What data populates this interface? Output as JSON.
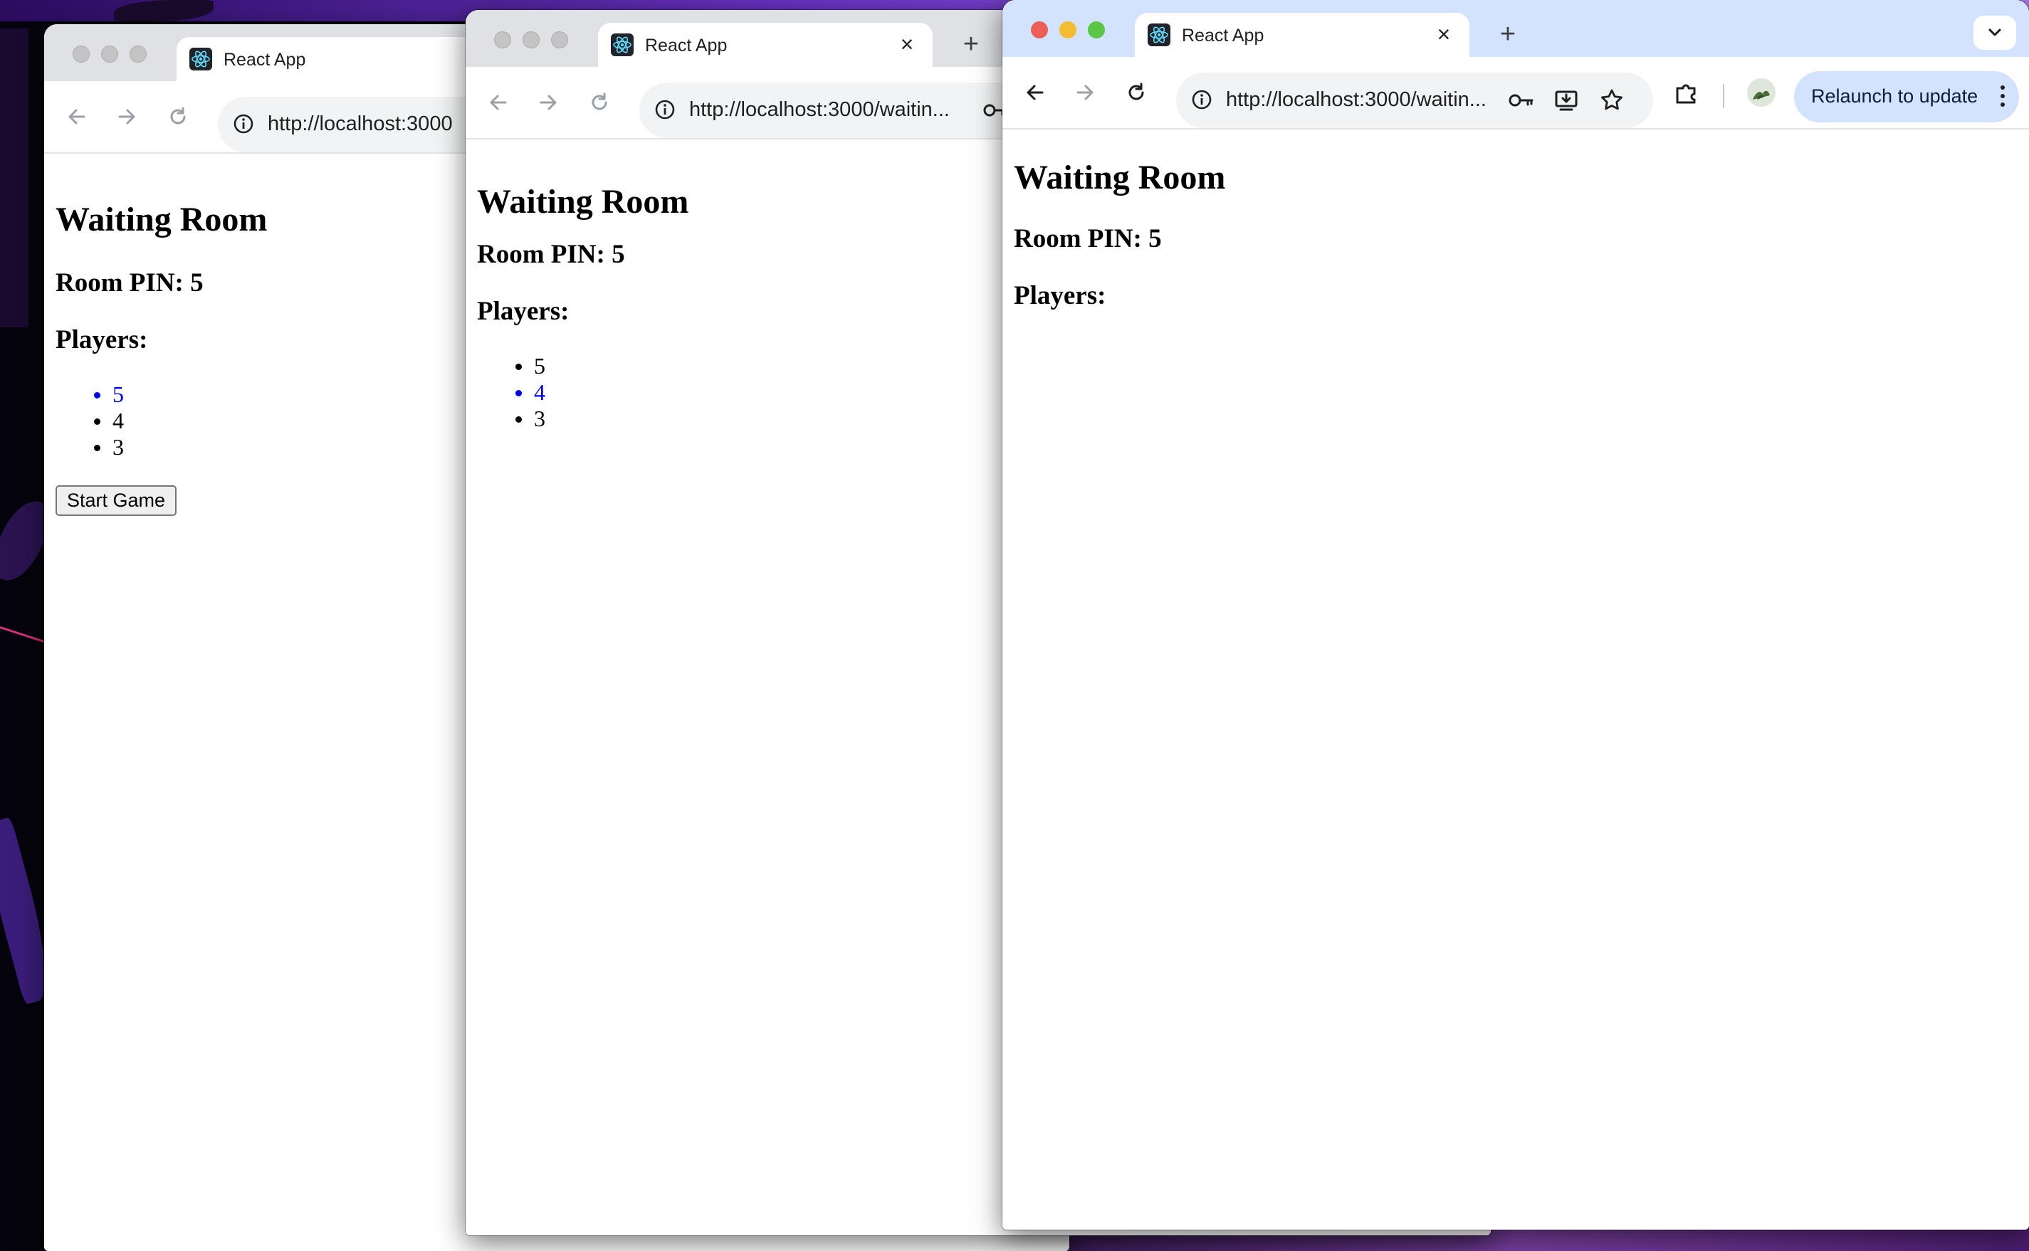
{
  "windows": [
    {
      "tab_title": "React App",
      "url": "http://localhost:3000",
      "heading": "Waiting Room",
      "room_pin": "Room PIN: 5",
      "players_label": "Players:",
      "players": [
        {
          "name": "5",
          "highlighted": true
        },
        {
          "name": "4",
          "highlighted": false
        },
        {
          "name": "3",
          "highlighted": false
        }
      ],
      "start_button": "Start Game"
    },
    {
      "tab_title": "React App",
      "url": "http://localhost:3000/waitin...",
      "heading": "Waiting Room",
      "room_pin": "Room PIN: 5",
      "players_label": "Players:",
      "players": [
        {
          "name": "5",
          "highlighted": false
        },
        {
          "name": "4",
          "highlighted": true
        },
        {
          "name": "3",
          "highlighted": false
        }
      ]
    },
    {
      "tab_title": "React App",
      "url": "http://localhost:3000/waitin...",
      "heading": "Waiting Room",
      "room_pin": "Room PIN: 5",
      "players_label": "Players:",
      "players": [],
      "relaunch_label": "Relaunch to update"
    }
  ],
  "colors": {
    "highlight": "#0000ee",
    "active_tabstrip": "#d3e3fd",
    "inactive_tabstrip": "#dfe1e5",
    "relaunch_bg": "#d3e3fd"
  },
  "icons": [
    "react-logo-icon",
    "close-icon",
    "plus-icon",
    "back-arrow-icon",
    "forward-arrow-icon",
    "reload-icon",
    "info-icon",
    "key-icon",
    "install-icon",
    "star-icon",
    "extensions-icon",
    "profile-avatar",
    "more-vert-icon",
    "chevron-down-icon"
  ]
}
